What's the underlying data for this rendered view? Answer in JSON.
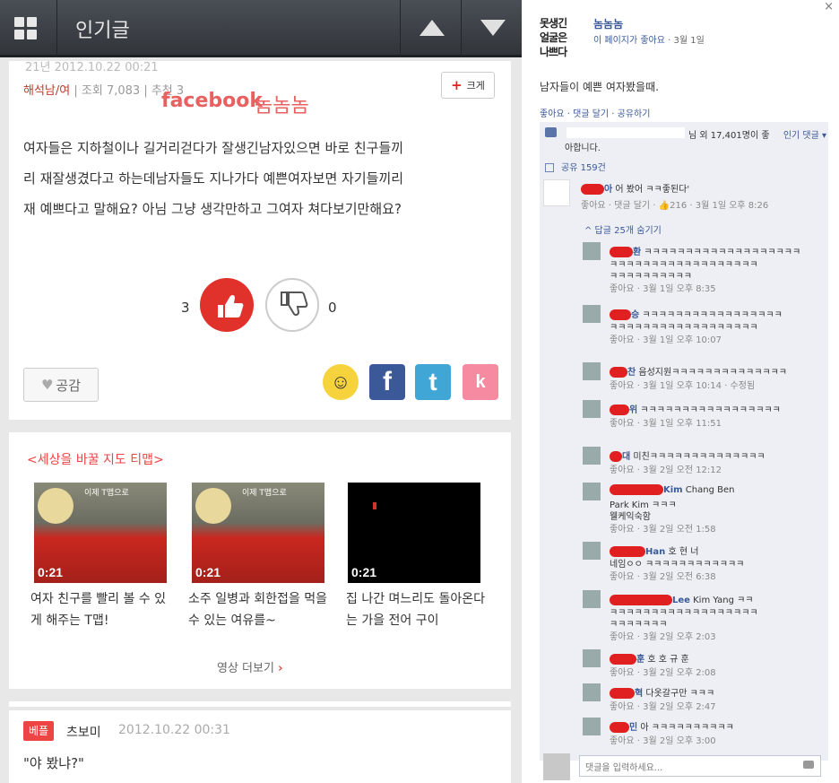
{
  "app": {
    "title": "인기글"
  },
  "post": {
    "timestamp_cut": "21년 2012.10.22 00:21",
    "author": "해석남/여",
    "views": "조회 7,083",
    "recommend": "추천 3",
    "watermark_fb": "facebook",
    "watermark_page": "놈놈놈",
    "big_label": "크게",
    "body_lines": [
      "여자들은 지하철이나 길거리걷다가 잘생긴남자있으면 바로 친구들끼",
      "리 재잘생겼다고 하는데남자들도 지나가다 예쁜여자보면 자기들끼리",
      "재 예쁘다고 말해요? 아님 그냥 생각만하고 그여자 쳐다보기만해요?"
    ],
    "up_count": "3",
    "down_count": "0",
    "empathy_label": "공감",
    "share_icons": {
      "facebook": "f",
      "twitter": "t",
      "kakao": "k"
    }
  },
  "tmap": {
    "title": "<세상을 바꿀 지도 티맵>",
    "videos": [
      {
        "duration": "0:21",
        "brand": "이제 T맵으로",
        "caption": "여자 친구를 빨리 볼 수 있게 해주는 T맵!"
      },
      {
        "duration": "0:21",
        "brand": "이제 T맵으로",
        "caption": "소주 일병과 회한접을 먹을 수 있는 여유를~"
      },
      {
        "duration": "0:21",
        "brand": "",
        "caption": "집 나간 며느리도 돌아온다는 가을 전어 구이"
      }
    ],
    "more": "영상 더보기"
  },
  "comment2": {
    "badge": "베플",
    "name": "츠보미",
    "date": "2012.10.22 00:31",
    "text": "\"야 봤냐?\""
  },
  "fb": {
    "close": "×",
    "logo_lines": [
      "못생긴",
      "얼굴은",
      "나쁘다"
    ],
    "page_name": "놈놈놈",
    "page_meta_like": "이 페이지가 좋아요",
    "page_meta_date": "· 3월 1일",
    "post_text": "남자들이 예쁜 여자봤을때.",
    "actions": "좋아요 · 댓글 달기 · 공유하기",
    "likes_text": "님 외 17,401명이 좋",
    "likes_text2": "아합니다.",
    "sort": "인기 댓글 ▾",
    "shares": "공유 159건",
    "top_comment": {
      "name": "아",
      "text": "어 봤어 ㅋㅋ좋된다'",
      "meta": "좋아요 · 댓글 달기 · 👍216 · 3월 1일 오후 8:26"
    },
    "replies_toggle": "^     답글 25개 숨기기",
    "replies": [
      {
        "name": "환",
        "text": "ㅋㅋㅋㅋㅋㅋㅋㅋㅋㅋㅋㅋㅋㅋㅋㅋㅋㅋㅋ",
        "text2": "ㅋㅋㅋㅋㅋㅋㅋㅋㅋㅋㅋㅋㅋㅋㅋㅋㅋㅋ",
        "text3": "ㅋㅋㅋㅋㅋㅋㅋㅋㅋㅋ",
        "meta": "좋아요 · 3월 1일 오후 8:35"
      },
      {
        "name": "승",
        "text": "ㅋㅋㅋㅋㅋㅋㅋㅋㅋㅋㅋㅋㅋㅋㅋㅋㅋ",
        "text2": "ㅋㅋㅋㅋㅋㅋㅋㅋㅋㅋㅋㅋㅋㅋㅋㅋㅋㅋ",
        "text3": "",
        "meta": "좋아요 · 3월 1일 오후 10:07"
      },
      {
        "name": "찬",
        "text": "음성지원ㅋㅋㅋㅋㅋㅋㅋㅋㅋㅋㅋㅋㅋㅋ",
        "text2": "",
        "text3": "",
        "meta": "좋아요 · 3월 1일 오후 10:14 · 수정됨"
      },
      {
        "name": "위",
        "text": "ㅋㅋㅋㅋㅋㅋㅋㅋㅋㅋㅋㅋㅋㅋㅋㅋㅋ",
        "text2": "",
        "text3": "",
        "meta": "좋아요 · 3월 1일 오후 11:51"
      },
      {
        "name": "대",
        "text": "미친ㅋㅋㅋㅋㅋㅋㅋㅋㅋㅋㅋㅋㅋㅋ",
        "text2": "",
        "text3": "",
        "meta": "좋아요 · 3월 2일 오전 12:12"
      },
      {
        "name": "Kim",
        "text": "Chang    Ben",
        "text2": "Park    Kim ㅋㅋㅋ",
        "text3": "웰케익숙함",
        "meta": "좋아요 · 3월 2일 오전 1:58"
      },
      {
        "name": "Han",
        "text": "호    현 너",
        "text2": "네임ㅇㅇ ㅋㅋㅋㅋㅋㅋㅋㅋㅋㅋㅋㅋ",
        "text3": "",
        "meta": "좋아요 · 3월 2일 오전 6:38"
      },
      {
        "name": "Lee",
        "text": "Kim    Yang ㅋㅋ",
        "text2": "ㅋㅋㅋㅋㅋㅋㅋㅋㅋㅋㅋㅋㅋㅋㅋㅋㅋㅋ",
        "text3": "ㅋㅋㅋㅋㅋㅋㅋ",
        "meta": "좋아요 · 3월 2일 오후 2:03"
      },
      {
        "name": "훈",
        "text": "호  호  규  훈",
        "text2": "",
        "text3": "",
        "meta": "좋아요 · 3월 2일 오후 2:08"
      },
      {
        "name": "혁",
        "text": "다옷갈구만 ㅋㅋㅋ",
        "text2": "",
        "text3": "",
        "meta": "좋아요 · 3월 2일 오후 2:47"
      },
      {
        "name": "민",
        "text": "아 ㅋㅋㅋㅋㅋㅋㅋㅋㅋㅋ",
        "text2": "",
        "text3": "",
        "meta": "좋아요 · 3월 2일 오후 3:00"
      }
    ],
    "input_placeholder": "댓글을 입력하세요..."
  },
  "colors": {
    "accent_red": "#e0322b",
    "fb_blue": "#3b5998",
    "topbar": "#3a3e44"
  }
}
